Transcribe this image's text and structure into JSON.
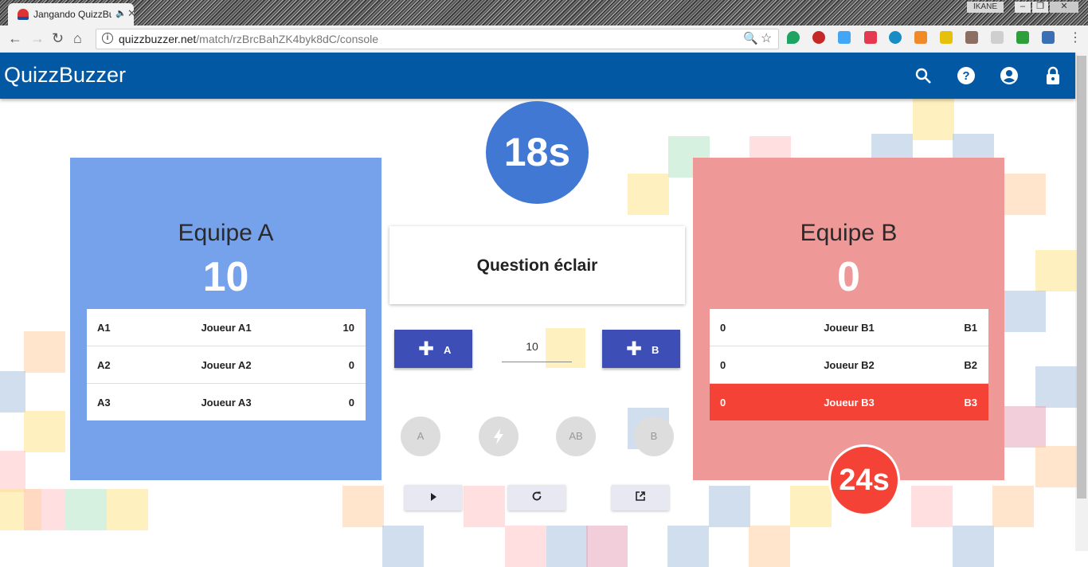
{
  "browser": {
    "tab_title": "Jangando QuizzBuzzer",
    "url_host": "quizzbuzzer.net",
    "url_path": "/match/rzBrcBahZK4byk8dC/console",
    "window_user": "IKANE"
  },
  "app": {
    "title": "QuizzBuzzer",
    "icons": [
      "search-icon",
      "help-icon",
      "account-icon",
      "lock-icon"
    ]
  },
  "timer_main": "18s",
  "timer_b": "24s",
  "question": {
    "label": "Question éclair"
  },
  "points_value": "10",
  "team_a": {
    "name": "Equipe A",
    "score": "10",
    "color": "#76a2ec",
    "players": [
      {
        "id": "A1",
        "name": "Joueur A1",
        "score": "10"
      },
      {
        "id": "A2",
        "name": "Joueur A2",
        "score": "0"
      },
      {
        "id": "A3",
        "name": "Joueur A3",
        "score": "0"
      }
    ]
  },
  "team_b": {
    "name": "Equipe B",
    "score": "0",
    "color": "#ee9898",
    "players": [
      {
        "score": "0",
        "name": "Joueur B1",
        "id": "B1"
      },
      {
        "score": "0",
        "name": "Joueur B2",
        "id": "B2"
      },
      {
        "score": "0",
        "name": "Joueur B3",
        "id": "B3",
        "active": true
      }
    ]
  },
  "buttons": {
    "add_a_label": "A",
    "add_b_label": "B",
    "mode_a": "A",
    "mode_ab": "AB",
    "mode_b": "B"
  },
  "colors": {
    "appbar": "#0258a3",
    "accent_button": "#3d4fb6",
    "active_player": "#f44336"
  }
}
